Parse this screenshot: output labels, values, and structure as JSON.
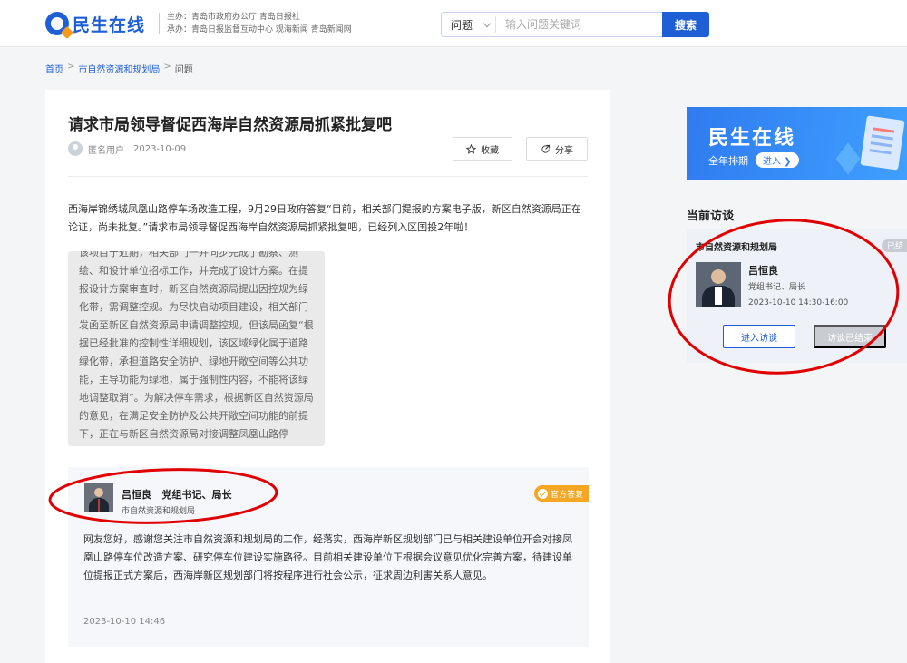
{
  "header": {
    "logo_text": "民生在线",
    "sponsor_line1": "主办：青岛市政府办公厅  青岛日报社",
    "sponsor_line2": "承办：青岛日报监督互动中心  观海新闻  青岛新闻网",
    "search_type": "问题",
    "search_placeholder": "输入问题关键词",
    "search_button": "搜索",
    "brand_color": "#1f5fd6"
  },
  "breadcrumb": {
    "home": "首页",
    "sep": ">",
    "department": "市自然资源和规划局",
    "current": "问题"
  },
  "question": {
    "title": "请求市局领导督促西海岸自然资源局抓紧批复吧",
    "author": "匿名用户",
    "date": "2023-10-09",
    "favorite_label": "收藏",
    "share_label": "分享",
    "content": "西海岸锦绣城凤凰山路停车场改造工程，9月29日政府答复“目前，相关部门提报的方案电子版，新区自然资源局正在论证，尚未批复。”请求市局领导督促西海岸自然资源局抓紧批复吧，已经列入区国投2年啦！",
    "overlay_text": "该项目于近期，相关部门一并同步完成了勘察、测绘、和设计单位招标工作，并完成了设计方案。在提报设计方案审查时，新区自然资源局提出因控规为绿化带，需调整控规。为尽快启动项目建设，相关部门发函至新区自然资源局申请调整控规，但该局函复“根据已经批准的控制性详细规划，该区域绿化属于道路绿化带，承担道路安全防护、绿地开敞空间等公共功能，主导功能为绿地，属于强制性内容，不能将该绿地调整取消”。为解决停车需求，根据新区自然资源局的意见，在满足安全防护及公共开敞空间功能的前提下，正在与新区自然资源局对接调整凤凰山路停"
  },
  "answer": {
    "name": "吕恒良",
    "title": "党组书记、局长",
    "department": "市自然资源和规划局",
    "badge": "官方答复",
    "badge_color": "#f5a623",
    "content": "网友您好，感谢您关注市自然资源和规划局的工作，经落实，西海岸新区规划部门已与相关建设单位开会对接凤凰山路停车位改造方案、研究停车位建设实施路径。目前相关建设单位正根据会议意见优化完善方案，待建设单位提报正式方案后，西海岸新区规划部门将按程序进行社会公示，征求周边利害关系人意见。",
    "time": "2023-10-10 14:46"
  },
  "sidebar": {
    "banner_title": "民生在线",
    "banner_sub": "全年排期",
    "banner_enter": "进入",
    "current_title": "当前访谈",
    "interview": {
      "department": "市自然资源和规划局",
      "status": "已结",
      "name": "吕恒良",
      "role": "党组书记、局长",
      "time": "2023-10-10 14:30-16:00",
      "enter_button": "进入访谈",
      "ended_button": "访谈已结束"
    }
  },
  "annotation_color": "#e00000"
}
